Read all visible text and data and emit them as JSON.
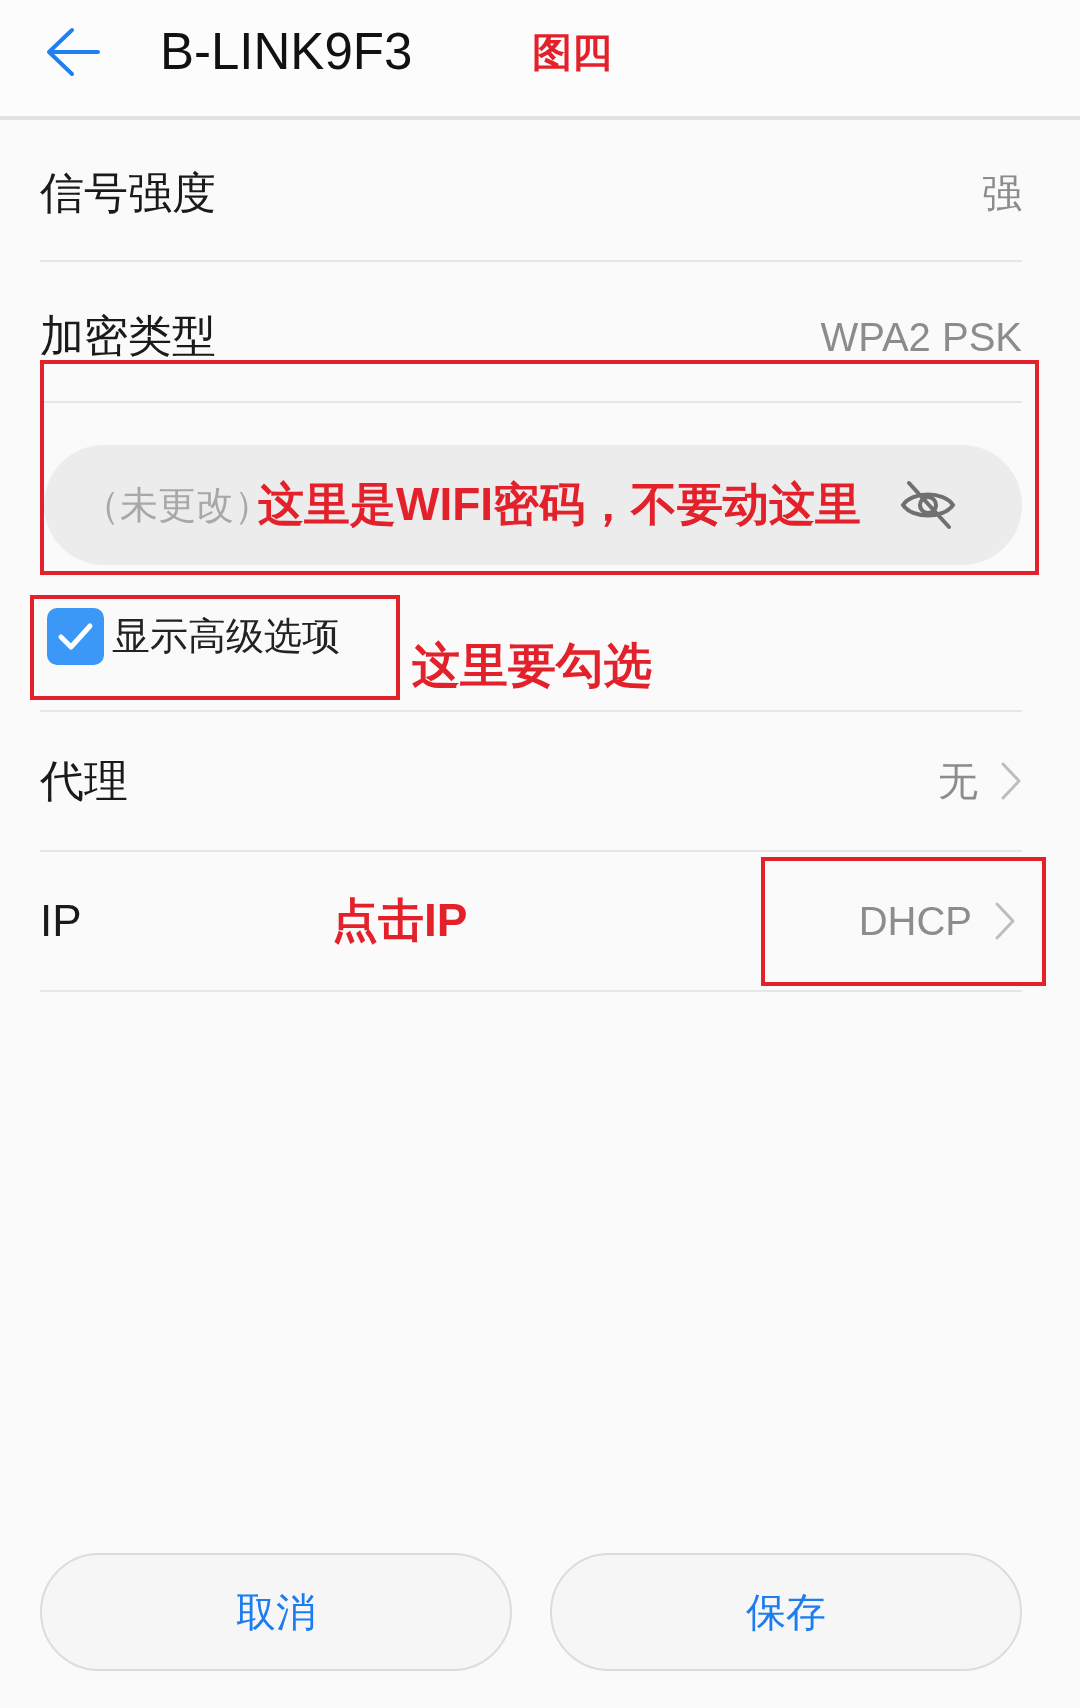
{
  "header": {
    "title": "B-LINK9F3",
    "figure_label": "图四"
  },
  "info_rows": [
    {
      "label": "信号强度",
      "value": "强"
    },
    {
      "label": "加密类型",
      "value": "WPA2 PSK"
    }
  ],
  "password": {
    "placeholder": "（未更改）",
    "visible": false,
    "note": "这里是WIFI密码，不要动这里"
  },
  "advanced_option": {
    "label": "显示高级选项",
    "checked": true,
    "note": "这里要勾选"
  },
  "setting_rows": [
    {
      "label": "代理",
      "value": "无"
    },
    {
      "label": "IP",
      "value": "DHCP",
      "note": "点击IP"
    }
  ],
  "buttons": [
    "取消",
    "保存"
  ]
}
